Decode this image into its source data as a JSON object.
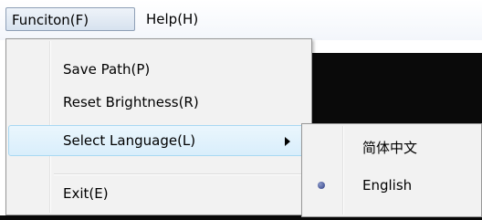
{
  "menubar": {
    "function_label": "Funciton(F)",
    "help_label": "Help(H)"
  },
  "function_menu": {
    "items": [
      {
        "label": "Save Path(P)"
      },
      {
        "label": "Reset Brightness(R)"
      },
      {
        "label": "Select Language(L)",
        "has_submenu": true,
        "highlighted": true
      },
      {
        "label": "Exit(E)"
      }
    ]
  },
  "language_submenu": {
    "items": [
      {
        "label": "简体中文",
        "selected": false
      },
      {
        "label": "English",
        "selected": true
      }
    ]
  },
  "colors": {
    "highlight": "#d9eefb",
    "menu_bg": "#f2f2f2",
    "app_bg": "#0a0a0a",
    "radio_dot": "#2f3f86"
  },
  "icons": {
    "submenu_arrow": "chevron-right-icon",
    "radio": "radio-selected-icon"
  }
}
